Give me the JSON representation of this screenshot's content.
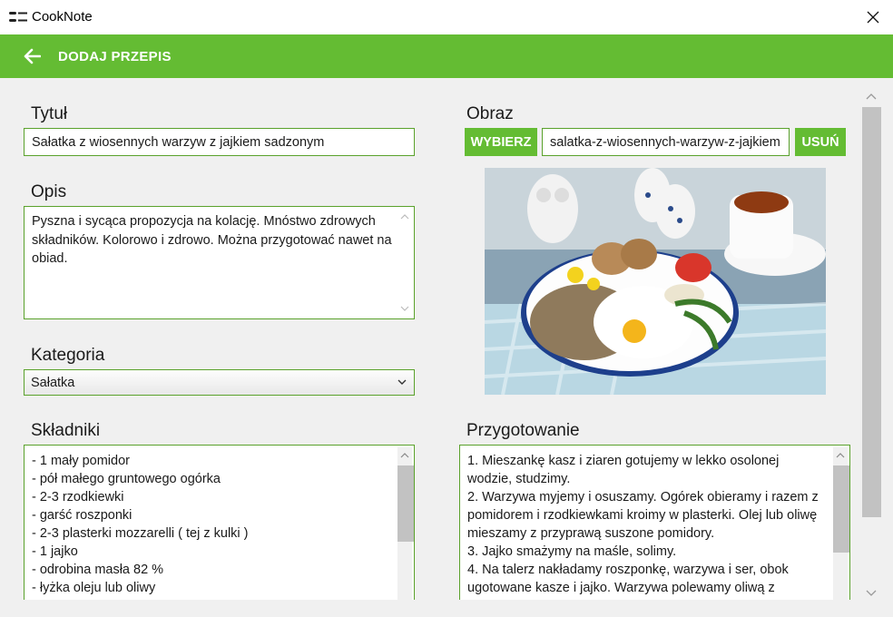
{
  "window": {
    "title": "CookNote",
    "close_icon": "close-icon"
  },
  "header": {
    "title": "DODAJ PRZEPIS",
    "back_icon": "arrow-left-icon",
    "color": "#64bc33"
  },
  "form": {
    "title_label": "Tytuł",
    "title_value": "Sałatka z wiosennych warzyw z jajkiem sadzonym",
    "description_label": "Opis",
    "description_value": "Pyszna i sycąca propozycja na kolację. Mnóstwo zdrowych składników. Kolorowo i zdrowo. Można przygotować nawet na obiad.",
    "category_label": "Kategoria",
    "category_value": "Sałatka",
    "ingredients_label": "Składniki",
    "ingredients": [
      "- 1 mały pomidor",
      "- pół małego gruntowego ogórka",
      "- 2-3 rzodkiewki",
      "- garść roszponki",
      "- 2-3 plasterki mozzarelli ( tej z kulki )",
      "- 1 jajko",
      "- odrobina masła 82 %",
      "- łyżka oleju lub oliwy"
    ],
    "image_label": "Obraz",
    "choose_button": "WYBIERZ",
    "image_filename": "salatka-z-wiosennych-warzyw-z-jajkiem",
    "remove_button": "USUŃ",
    "preparation_label": "Przygotowanie",
    "preparation": [
      "1. Mieszankę kasz i ziaren gotujemy w lekko osolonej wodzie, studzimy.",
      "2. Warzywa myjemy i osuszamy. Ogórek obieramy i razem z pomidorem i rzodkiewkami kroimy w plasterki. Olej lub oliwę mieszamy z przyprawą suszone pomidory.",
      "3. Jajko smażymy na maśle, solimy.",
      "4. Na talerz nakładamy roszponkę, warzywa i ser, obok ugotowane kasze i jajko. Warzywa polewamy oliwą z"
    ]
  }
}
